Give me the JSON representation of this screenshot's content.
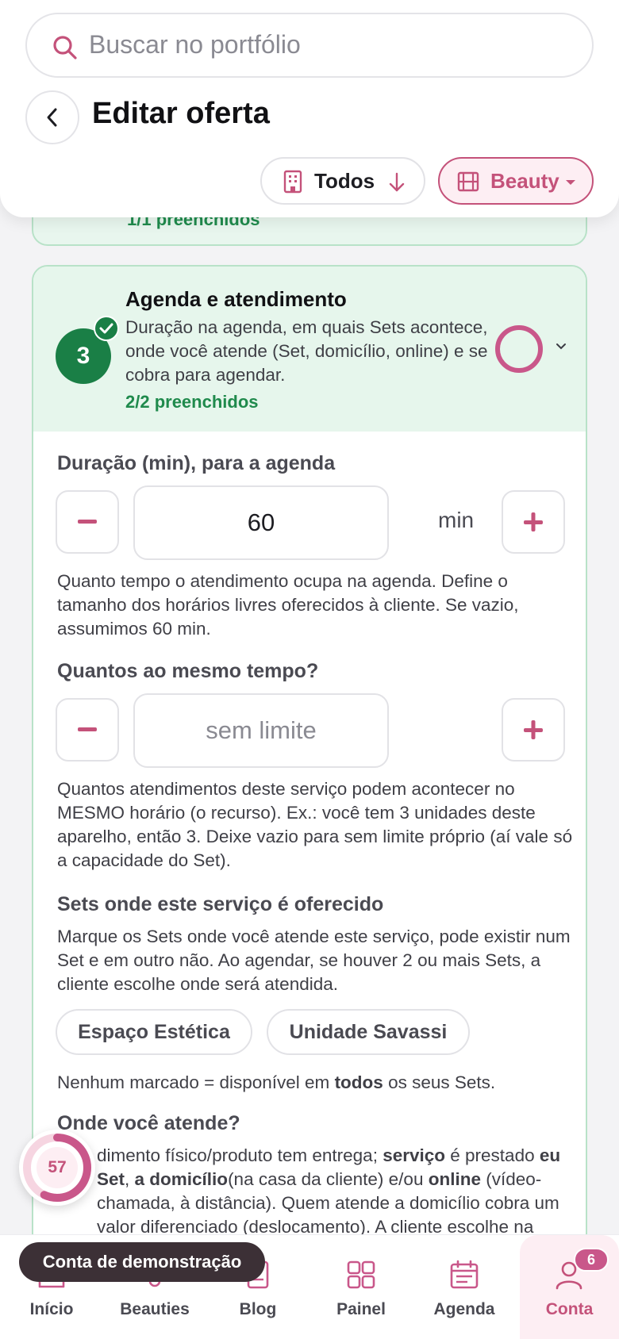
{
  "search": {
    "placeholder": "Buscar no portfólio"
  },
  "header": {
    "title": "Editar oferta"
  },
  "filters": {
    "scope_label": "Todos",
    "category_label": "Beauty"
  },
  "previous_section": {
    "filled": "1/1 preenchidos"
  },
  "section": {
    "step_number": "3",
    "title": "Agenda e atendimento",
    "description": "Duração na agenda, em quais Sets acontece, onde você atende (Set, domicílio, online) e se cobra para agendar.",
    "filled": "2/2 preenchidos"
  },
  "duration": {
    "label": "Duração (min), para a agenda",
    "value": "60",
    "unit": "min",
    "help": "Quanto tempo o atendimento ocupa na agenda. Define o tamanho dos horários livres oferecidos à cliente. Se vazio, assumimos 60 min."
  },
  "concurrency": {
    "label": "Quantos ao mesmo tempo?",
    "placeholder": "sem limite",
    "help": "Quantos atendimentos deste serviço podem acontecer no MESMO horário (o recurso). Ex.: você tem 3 unidades deste aparelho, então 3. Deixe vazio para sem limite próprio (aí vale só a capacidade do Set)."
  },
  "sets": {
    "label": "Sets onde este serviço é oferecido",
    "help": "Marque os Sets onde você atende este serviço, pode existir num Set e em outro não. Ao agendar, se houver 2 ou mais Sets, a cliente escolhe onde será atendida.",
    "options": [
      "Espaço Estética",
      "Unidade Savassi"
    ],
    "note_before": "Nenhum marcado = disponível em ",
    "note_bold": "todos",
    "note_after": " os seus Sets."
  },
  "location": {
    "label": "Onde você atende?",
    "help_parts": [
      "dimento físico/produto tem entrega; ",
      "serviço",
      " é prestado ",
      "eu Set",
      ", ",
      "a domicílio",
      "(na casa da cliente) e/ou ",
      "online",
      " (vídeo-chamada, à distância). Quem atende a domicílio cobra um valor diferenciado (deslocamento). A cliente escolhe na"
    ]
  },
  "progress": {
    "value": "57",
    "fraction": 0.57
  },
  "demo_toast": "Conta de demonstração",
  "nav": {
    "items": [
      "Início",
      "Beauties",
      "Blog",
      "Painel",
      "Agenda",
      "Conta"
    ],
    "badge": "6"
  },
  "colors": {
    "accent": "#c4527a",
    "success": "#1a7f46",
    "section_bg": "#e6f6ec"
  }
}
